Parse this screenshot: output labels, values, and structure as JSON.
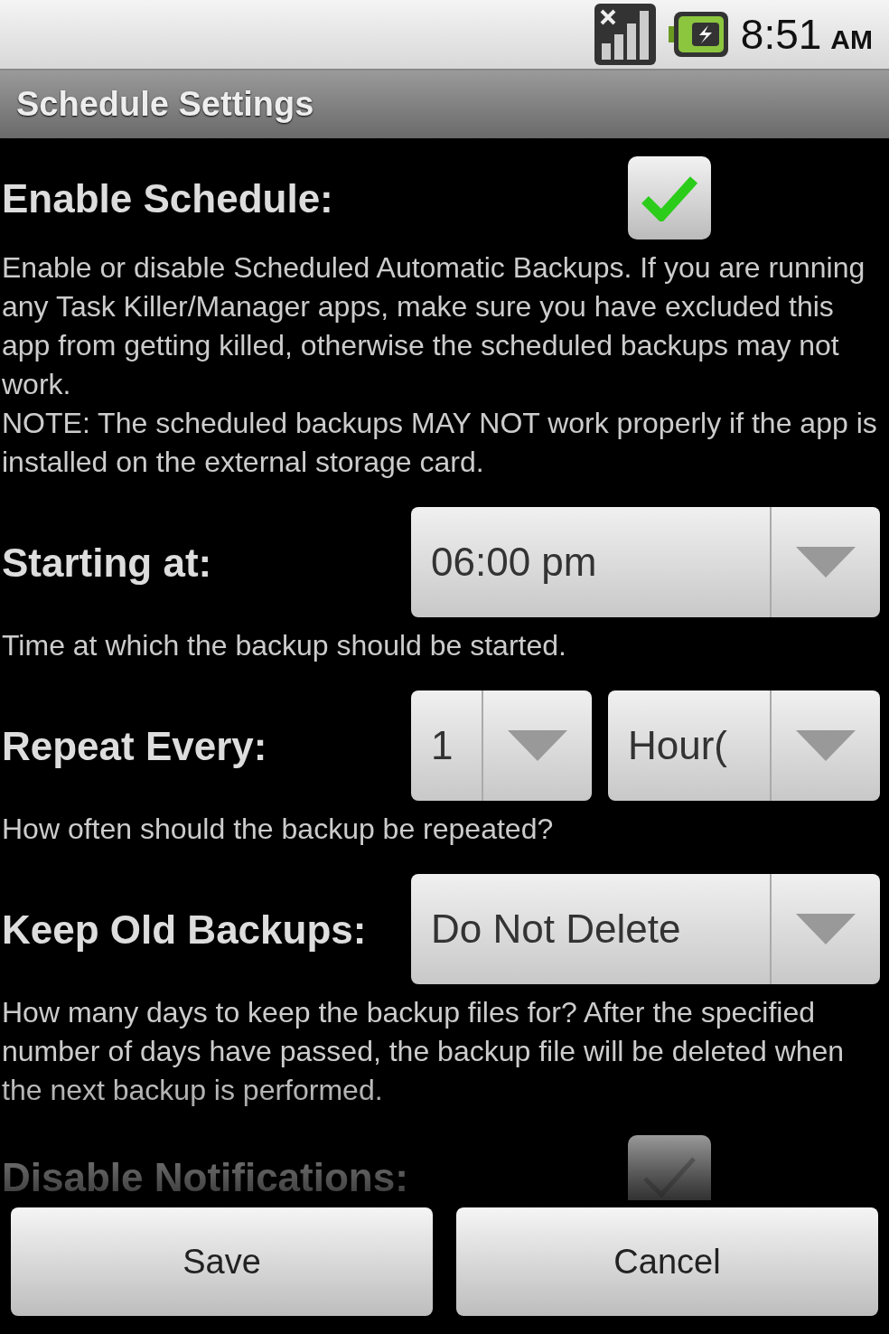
{
  "status_bar": {
    "time": "8:51",
    "ampm": "AM"
  },
  "title": "Schedule Settings",
  "settings": [
    {
      "kind": "checkbox",
      "label": "Enable Schedule:",
      "checked": true,
      "description": "Enable or disable Scheduled Automatic Backups. If you are running any Task Killer/Manager apps, make sure you have excluded this app from getting killed, otherwise the scheduled backups may not work.\nNOTE: The scheduled backups MAY NOT work properly if the app is installed on the external storage card."
    },
    {
      "kind": "spinners",
      "label": "Starting at:",
      "spinners": [
        "06:00 pm"
      ],
      "description": "Time at which the backup should be started."
    },
    {
      "kind": "spinners",
      "label": "Repeat Every:",
      "spinners": [
        "1",
        "Hour("
      ],
      "description": "How often should the backup be repeated?"
    },
    {
      "kind": "spinners",
      "label": "Keep Old Backups:",
      "spinners": [
        "Do Not Delete"
      ],
      "description": "How many days to keep the backup files for? After the specified number of days have passed, the backup file will be deleted when the next backup is performed."
    },
    {
      "kind": "checkbox",
      "label": "Disable Notifications:",
      "checked": false
    }
  ],
  "buttons": [
    "Save",
    "Cancel"
  ]
}
